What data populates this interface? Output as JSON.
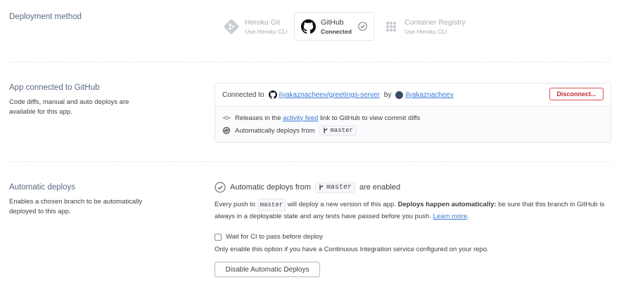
{
  "deployment": {
    "title": "Deployment method",
    "methods": [
      {
        "name": "Heroku Git",
        "sub": "Use Heroku CLI"
      },
      {
        "name": "GitHub",
        "sub": "Connected"
      },
      {
        "name": "Container Registry",
        "sub": "Use Heroku CLI"
      }
    ]
  },
  "connected": {
    "title": "App connected to GitHub",
    "desc": "Code diffs, manual and auto deploys are available for this app.",
    "connected_to": "Connected to",
    "repo": "ilyakaznacheev/greetings-server",
    "by": "by",
    "user": "ilyakaznacheev",
    "disconnect": "Disconnect...",
    "releases_pre": "Releases in the",
    "activity_feed": "activity feed",
    "releases_post": "link to GitHub to view commit diffs",
    "auto_from": "Automatically deploys from",
    "branch": "master"
  },
  "auto": {
    "title": "Automatic deploys",
    "desc": "Enables a chosen branch to be automatically deployed to this app.",
    "status_pre": "Automatic deploys from",
    "branch": "master",
    "status_post": "are enabled",
    "text_a": "Every push to",
    "text_b": "will deploy a new version of this app.",
    "text_bold": "Deploys happen automatically:",
    "text_c": "be sure that this branch in GitHub is always in a deployable state and any tests have passed before you push.",
    "learn_more": "Learn more",
    "ci_label": "Wait for CI to pass before deploy",
    "ci_note": "Only enable this option if you have a Continuous Integration service configured on your repo.",
    "disable_button": "Disable Automatic Deploys"
  }
}
